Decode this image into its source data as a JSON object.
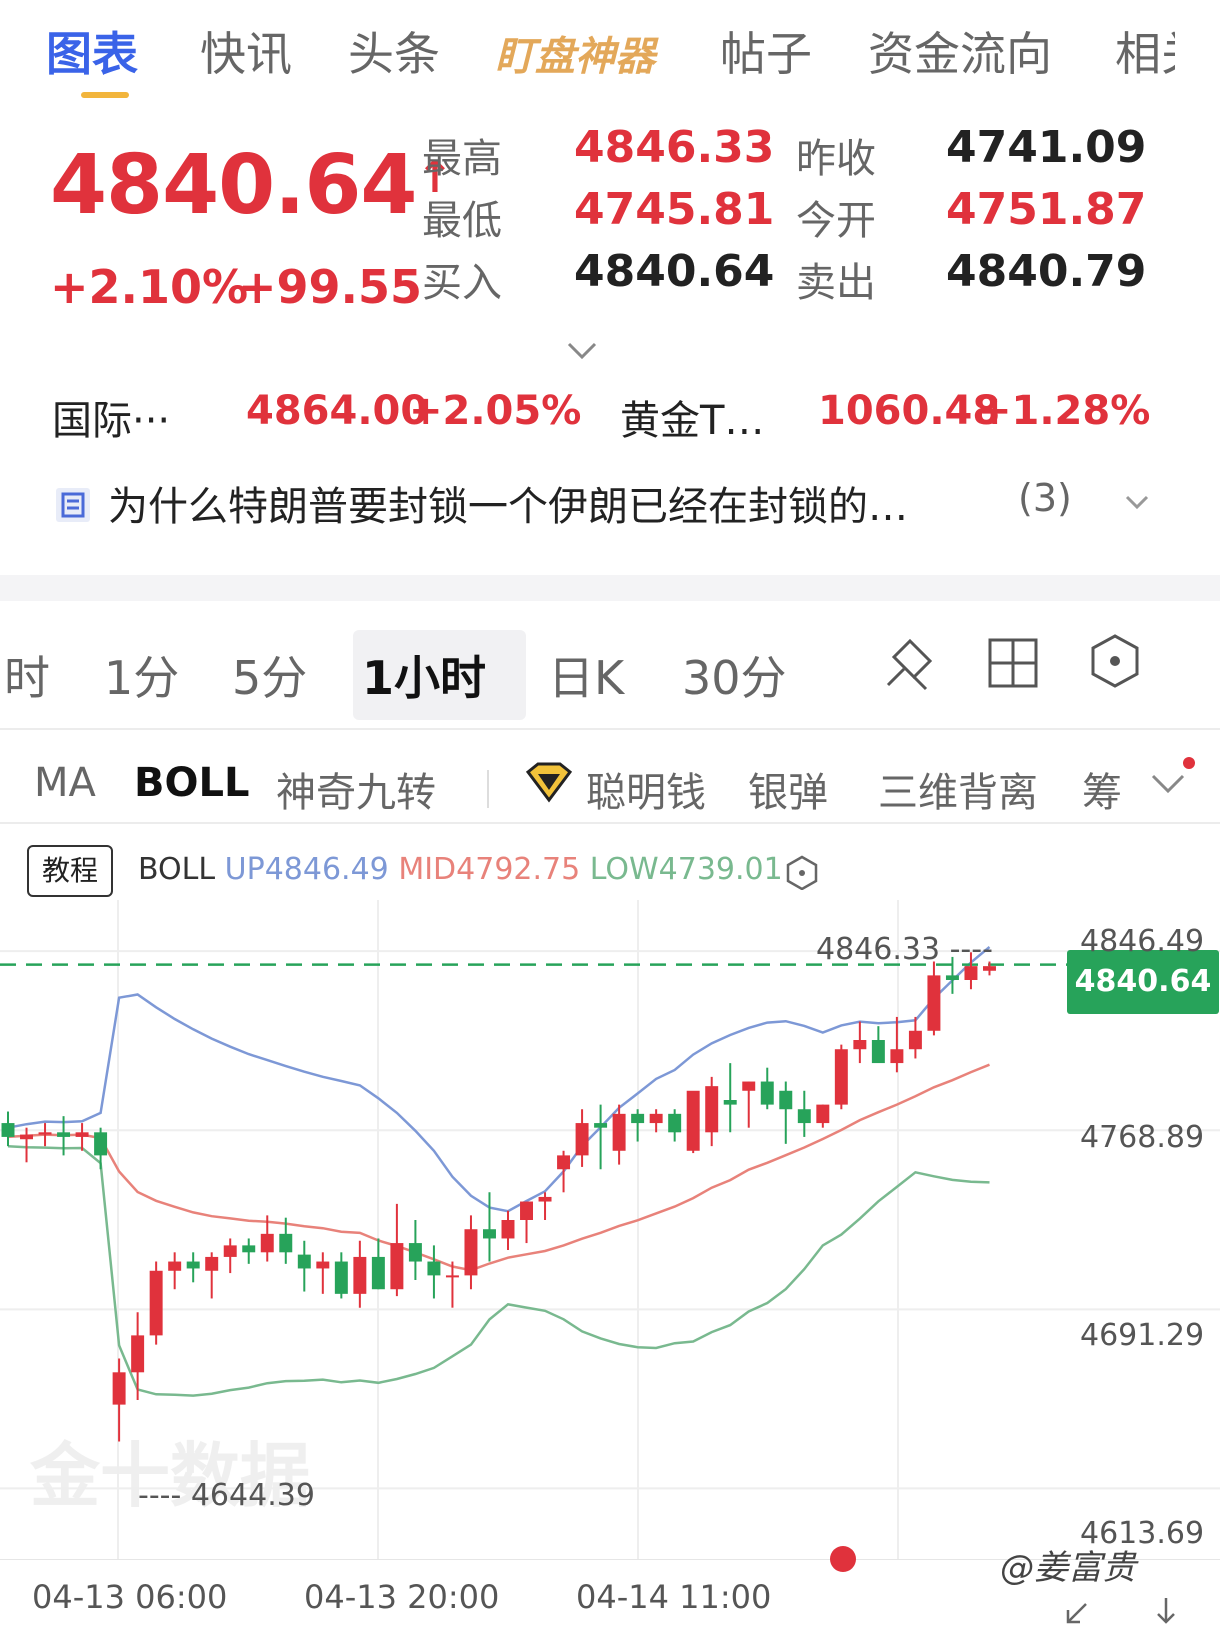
{
  "top_tabs": [
    "图表",
    "快讯",
    "头条",
    "盯盘神器",
    "帖子",
    "资金流向",
    "相关"
  ],
  "quote": {
    "price": "4840.64",
    "arrow": "↑",
    "change_pct": "+2.10%",
    "change_abs": "+99.55",
    "high_label": "最高",
    "high": "4846.33",
    "low_label": "最低",
    "low": "4745.81",
    "bid_label": "买入",
    "bid": "4840.64",
    "prev_close_label": "昨收",
    "prev_close": "4741.09",
    "open_label": "今开",
    "open": "4751.87",
    "ask_label": "卖出",
    "ask": "4840.79"
  },
  "related": [
    {
      "name": "国际···",
      "price": "4864.00",
      "change": "+2.05%"
    },
    {
      "name": "黄金T…",
      "price": "1060.48",
      "change": "+1.28%"
    }
  ],
  "news": {
    "title": "为什么特朗普要封锁一个伊朗已经在封锁的…",
    "count": "(3)"
  },
  "periods": [
    "时",
    "1分",
    "5分",
    "1小时",
    "日K",
    "30分"
  ],
  "active_period": "1小时",
  "indicators": [
    "MA",
    "BOLL",
    "神奇九转",
    "聪明钱",
    "银弹",
    "三维背离",
    "筹"
  ],
  "active_indicator": "BOLL",
  "tutorial_label": "教程",
  "boll": {
    "label": "BOLL",
    "up": "UP4846.49",
    "mid": "MID4792.75",
    "low": "LOW4739.01"
  },
  "colors": {
    "red": "#e0323c",
    "green": "#27a35a",
    "boll_up": "#7d98d6",
    "boll_mid": "#e8827a",
    "boll_low": "#79b98f"
  },
  "chart_data": {
    "type": "candlestick",
    "price_ticks": [
      "4846.49",
      "4768.89",
      "4691.29",
      "4613.69"
    ],
    "current_price_tag": "4840.64",
    "high_annotation": "4846.33",
    "low_annotation": "4644.39",
    "x_ticks": [
      "04-13 06:00",
      "04-13 20:00",
      "04-14 11:00"
    ],
    "ylim": [
      4600,
      4860
    ],
    "candles": [
      [
        4772,
        4777,
        4762,
        4766
      ],
      [
        4765,
        4770,
        4755,
        4767
      ],
      [
        4767,
        4772,
        4762,
        4768
      ],
      [
        4768,
        4775,
        4758,
        4766
      ],
      [
        4766,
        4772,
        4760,
        4768
      ],
      [
        4768,
        4770,
        4752,
        4758
      ],
      [
        4650,
        4670,
        4634,
        4664
      ],
      [
        4664,
        4690,
        4652,
        4680
      ],
      [
        4680,
        4712,
        4676,
        4708
      ],
      [
        4708,
        4716,
        4700,
        4712
      ],
      [
        4712,
        4716,
        4703,
        4709
      ],
      [
        4708,
        4716,
        4696,
        4714
      ],
      [
        4714,
        4722,
        4707,
        4719
      ],
      [
        4719,
        4722,
        4711,
        4716
      ],
      [
        4716,
        4732,
        4712,
        4724
      ],
      [
        4724,
        4731,
        4711,
        4716
      ],
      [
        4715,
        4721,
        4699,
        4709
      ],
      [
        4709,
        4716,
        4698,
        4712
      ],
      [
        4712,
        4716,
        4696,
        4698
      ],
      [
        4698,
        4721,
        4692,
        4714
      ],
      [
        4714,
        4722,
        4700,
        4700
      ],
      [
        4700,
        4737,
        4697,
        4720
      ],
      [
        4720,
        4730,
        4704,
        4712
      ],
      [
        4712,
        4719,
        4696,
        4706
      ],
      [
        4706,
        4712,
        4692,
        4706
      ],
      [
        4706,
        4732,
        4700,
        4726
      ],
      [
        4726,
        4742,
        4712,
        4722
      ],
      [
        4722,
        4734,
        4717,
        4730
      ],
      [
        4730,
        4738,
        4720,
        4738
      ],
      [
        4738,
        4742,
        4730,
        4740
      ],
      [
        4752,
        4760,
        4742,
        4758
      ],
      [
        4758,
        4778,
        4753,
        4772
      ],
      [
        4772,
        4780,
        4752,
        4770
      ],
      [
        4760,
        4780,
        4754,
        4776
      ],
      [
        4776,
        4778,
        4764,
        4772
      ],
      [
        4772,
        4778,
        4768,
        4776
      ],
      [
        4776,
        4778,
        4764,
        4768
      ],
      [
        4760,
        4777,
        4759,
        4786
      ],
      [
        4768,
        4792,
        4762,
        4788
      ],
      [
        4782,
        4798,
        4768,
        4780
      ],
      [
        4786,
        4790,
        4770,
        4790
      ],
      [
        4790,
        4796,
        4778,
        4780
      ],
      [
        4786,
        4790,
        4763,
        4778
      ],
      [
        4778,
        4786,
        4766,
        4772
      ],
      [
        4772,
        4780,
        4770,
        4780
      ],
      [
        4780,
        4806,
        4778,
        4804
      ],
      [
        4804,
        4816,
        4798,
        4808
      ],
      [
        4808,
        4814,
        4800,
        4798
      ],
      [
        4798,
        4818,
        4794,
        4804
      ],
      [
        4804,
        4818,
        4800,
        4812
      ],
      [
        4812,
        4842,
        4810,
        4836
      ],
      [
        4836,
        4844,
        4828,
        4834
      ],
      [
        4834,
        4846,
        4830,
        4840
      ],
      [
        4838,
        4842,
        4836,
        4840
      ]
    ]
  },
  "watermark": "金十数据",
  "credit": "@姜富贵"
}
